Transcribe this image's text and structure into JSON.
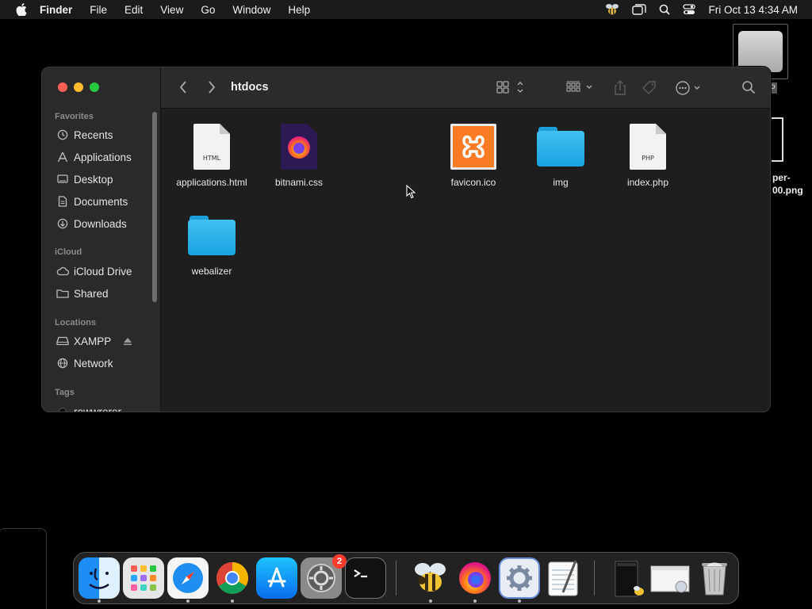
{
  "menubar": {
    "app_name": "Finder",
    "items": [
      "File",
      "Edit",
      "View",
      "Go",
      "Window",
      "Help"
    ],
    "clock": "Fri Oct 13  4:34 AM"
  },
  "desktop": {
    "drive_label": "P",
    "png_label_line1": "per-",
    "png_label_line2": "00.png"
  },
  "finder": {
    "title": "htdocs",
    "sidebar": {
      "favorites_header": "Favorites",
      "favorites": [
        {
          "label": "Recents",
          "icon": "clock-icon"
        },
        {
          "label": "Applications",
          "icon": "applications-icon"
        },
        {
          "label": "Desktop",
          "icon": "desktop-icon"
        },
        {
          "label": "Documents",
          "icon": "document-icon"
        },
        {
          "label": "Downloads",
          "icon": "download-icon"
        }
      ],
      "icloud_header": "iCloud",
      "icloud": [
        {
          "label": "iCloud Drive",
          "icon": "cloud-icon"
        },
        {
          "label": "Shared",
          "icon": "shared-folder-icon"
        }
      ],
      "locations_header": "Locations",
      "locations": [
        {
          "label": "XAMPP",
          "icon": "drive-icon"
        },
        {
          "label": "Network",
          "icon": "globe-icon"
        }
      ],
      "tags_header": "Tags",
      "tags": [
        {
          "label": "rewwrerer",
          "color": "#111111"
        }
      ]
    },
    "files": [
      {
        "name": "applications.html",
        "kind": "doc",
        "tag": "HTML"
      },
      {
        "name": "bitnami.css",
        "kind": "firefox-doc"
      },
      {
        "name": "favicon.ico",
        "kind": "xampp"
      },
      {
        "name": "img",
        "kind": "folder"
      },
      {
        "name": "index.php",
        "kind": "doc",
        "tag": "PHP"
      },
      {
        "name": "webalizer",
        "kind": "folder"
      }
    ]
  },
  "dock": {
    "items": [
      {
        "name": "finder",
        "running": true
      },
      {
        "name": "launchpad",
        "running": false
      },
      {
        "name": "safari",
        "running": true
      },
      {
        "name": "chrome",
        "running": true
      },
      {
        "name": "app-store",
        "running": false
      },
      {
        "name": "system-settings",
        "running": false,
        "badge": "2"
      },
      {
        "name": "terminal",
        "running": false
      },
      {
        "name": "xampp-bee",
        "running": true
      },
      {
        "name": "firefox",
        "running": true
      },
      {
        "name": "xampp-manager",
        "running": true
      },
      {
        "name": "textedit",
        "running": false
      },
      {
        "name": "recent-window-1",
        "running": false
      },
      {
        "name": "recent-window-2",
        "running": false
      },
      {
        "name": "trash",
        "running": false
      }
    ]
  },
  "colors": {
    "accent_folder": "#1aa3e0",
    "traffic_red": "#ff5f57",
    "traffic_yellow": "#febc2e",
    "traffic_green": "#28c840",
    "badge_red": "#ff3b30"
  }
}
